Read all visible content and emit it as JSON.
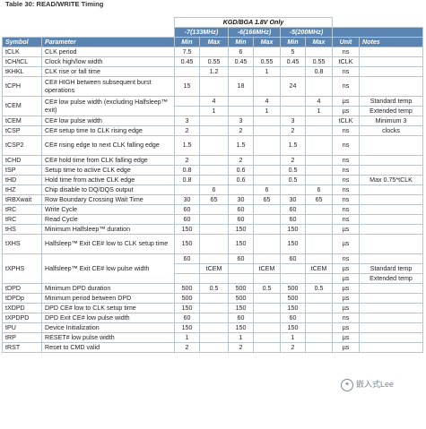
{
  "caption": "Table 30:  READ/WRITE Timing",
  "header": {
    "kgd": "KGD/BGA 1.8V Only",
    "speed_133": "-7(133MHz)",
    "speed_166": "-6(166MHz)",
    "speed_200": "-5(200MHz)",
    "symbol": "Symbol",
    "parameter": "Parameter",
    "min": "Min",
    "max": "Max",
    "unit": "Unit",
    "notes": "Notes"
  },
  "rows": {
    "tclk": {
      "sym": "tCLK",
      "param": "CLK period",
      "min7": "7.5",
      "max7": "",
      "min6": "6",
      "max6": "",
      "min5": "5",
      "max5": "",
      "unit": "ns",
      "notes": ""
    },
    "tch": {
      "sym": "tCH/tCL",
      "param": "Clock high/low width",
      "min7": "0.45",
      "max7": "0.55",
      "min6": "0.45",
      "max6": "0.55",
      "min5": "0.45",
      "max5": "0.55",
      "unit": "tCLK",
      "notes": ""
    },
    "tkhkl": {
      "sym": "tKHKL",
      "param": "CLK rise or fall time",
      "min7": "",
      "max7": "1.2",
      "min6": "",
      "max6": "1",
      "min5": "",
      "max5": "0.8",
      "unit": "ns",
      "notes": ""
    },
    "tcph": {
      "sym": "tCPH",
      "param": "CE# HIGH between subsequent burst operations",
      "min7": "15",
      "max7": "",
      "min6": "18",
      "max6": "",
      "min5": "24",
      "max5": "",
      "unit": "ns",
      "notes": ""
    },
    "tcem_a": {
      "sym": "tCEM",
      "param": "CE# low pulse width (excluding Halfsleep™ exit)",
      "max7": "4",
      "max6": "4",
      "max5": "4",
      "unit": "µs",
      "notes": "Standard temp"
    },
    "tcem_b": {
      "max7": "1",
      "max6": "1",
      "max5": "1",
      "unit": "µs",
      "notes": "Extended temp"
    },
    "tcem2": {
      "sym": "tCEM",
      "param": "CE# low pulse width",
      "min7": "3",
      "max7": "",
      "min6": "3",
      "max6": "",
      "min5": "3",
      "max5": "",
      "unit": "tCLK",
      "notes": "Minimum 3"
    },
    "tcsp": {
      "sym": "tCSP",
      "param": "CE# setup time to CLK rising edge",
      "min7": "2",
      "max7": "",
      "min6": "2",
      "max6": "",
      "min5": "2",
      "max5": "",
      "unit": "ns",
      "notes": "clocks"
    },
    "tcsp2": {
      "sym": "tCSP2",
      "param": "CE# rising edge to next CLK falling edge",
      "min7": "1.5",
      "max7": "",
      "min6": "1.5",
      "max6": "",
      "min5": "1.5",
      "max5": "",
      "unit": "ns",
      "notes": ""
    },
    "tchd": {
      "sym": "tCHD",
      "param": "CE# hold time from CLK falling edge",
      "min7": "2",
      "max7": "",
      "min6": "2",
      "max6": "",
      "min5": "2",
      "max5": "",
      "unit": "ns",
      "notes": ""
    },
    "tsp": {
      "sym": "tSP",
      "param": "Setup time to active CLK edge",
      "min7": "0.8",
      "max7": "",
      "min6": "0.6",
      "max6": "",
      "min5": "0.5",
      "max5": "",
      "unit": "ns",
      "notes": ""
    },
    "thd": {
      "sym": "tHD",
      "param": "Hold time from active CLK edge",
      "min7": "0.8",
      "max7": "",
      "min6": "0.6",
      "max6": "",
      "min5": "0.5",
      "max5": "",
      "unit": "ns",
      "notes": "Max 0.75*tCLK"
    },
    "thz": {
      "sym": "tHZ",
      "param": "Chip disable to DQ/DQS output",
      "min7": "",
      "max7": "6",
      "min6": "",
      "max6": "6",
      "min5": "",
      "max5": "6",
      "unit": "ns",
      "notes": ""
    },
    "trbx": {
      "sym": "tRBXwait",
      "param": "Row Boundary Crossing Wait Time",
      "min7": "30",
      "max7": "65",
      "min6": "30",
      "max6": "65",
      "min5": "30",
      "max5": "65",
      "unit": "ns",
      "notes": ""
    },
    "trc1": {
      "sym": "tRC",
      "param": "Write Cycle",
      "min7": "60",
      "max7": "",
      "min6": "60",
      "max6": "",
      "min5": "60",
      "max5": "",
      "unit": "ns",
      "notes": ""
    },
    "trc2": {
      "sym": "tRC",
      "param": "Read Cycle",
      "min7": "60",
      "max7": "",
      "min6": "60",
      "max6": "",
      "min5": "60",
      "max5": "",
      "unit": "ns",
      "notes": ""
    },
    "ths": {
      "sym": "tHS",
      "param": "Minimum Halfsleep™ duration",
      "min7": "150",
      "max7": "",
      "min6": "150",
      "max6": "",
      "min5": "150",
      "max5": "",
      "unit": "µs",
      "notes": ""
    },
    "txhs": {
      "sym": "tXHS",
      "param": "Halfsleep™ Exit CE# low to CLK setup time",
      "min7": "150",
      "max7": "",
      "min6": "150",
      "max6": "",
      "min5": "150",
      "max5": "",
      "unit": "µs",
      "notes": ""
    },
    "txphs_a": {
      "sym": "tXPHS",
      "param": "Halfsleep™ Exit CE# low pulse width",
      "min7": "60",
      "min6": "60",
      "min5": "60",
      "unit": "ns",
      "notes": ""
    },
    "txphs_b": {
      "max7": "tCEM",
      "max6": "tCEM",
      "max5": "tCEM",
      "unit": "µs",
      "notes": "Standard temp"
    },
    "txphs_c": {
      "unit": "µs",
      "notes": "Extended temp"
    },
    "tdpd": {
      "sym": "tDPD",
      "param": "Minimum DPD duration",
      "min7": "500",
      "max7": "0.5",
      "min6": "500",
      "max6": "0.5",
      "min5": "500",
      "max5": "0.5",
      "unit": "µs",
      "notes": ""
    },
    "tdpdp": {
      "sym": "tDPDp",
      "param": "Minimum period between DPD",
      "min7": "500",
      "max7": "",
      "min6": "500",
      "max6": "",
      "min5": "500",
      "max5": "",
      "unit": "µs",
      "notes": ""
    },
    "txdpd": {
      "sym": "tXDPD",
      "param": "DPD CE# low to CLK setup time",
      "min7": "150",
      "max7": "",
      "min6": "150",
      "max6": "",
      "min5": "150",
      "max5": "",
      "unit": "µs",
      "notes": ""
    },
    "txpdpd": {
      "sym": "tXPDPD",
      "param": "DPD Exit CE# low pulse width",
      "min7": "60",
      "max7": "",
      "min6": "60",
      "max6": "",
      "min5": "60",
      "max5": "",
      "unit": "ns",
      "notes": ""
    },
    "tpu": {
      "sym": "tPU",
      "param": "Device Initialization",
      "min7": "150",
      "max7": "",
      "min6": "150",
      "max6": "",
      "min5": "150",
      "max5": "",
      "unit": "µs",
      "notes": ""
    },
    "trp": {
      "sym": "tRP",
      "param": "RESET# low pulse width",
      "min7": "1",
      "max7": "",
      "min6": "1",
      "max6": "",
      "min5": "1",
      "max5": "",
      "unit": "µs",
      "notes": ""
    },
    "trst": {
      "sym": "tRST",
      "param": "Reset to CMD valid",
      "min7": "2",
      "max7": "",
      "min6": "2",
      "max6": "",
      "min5": "2",
      "max5": "",
      "unit": "µs",
      "notes": ""
    }
  },
  "watermark": "嵌入式Lee"
}
